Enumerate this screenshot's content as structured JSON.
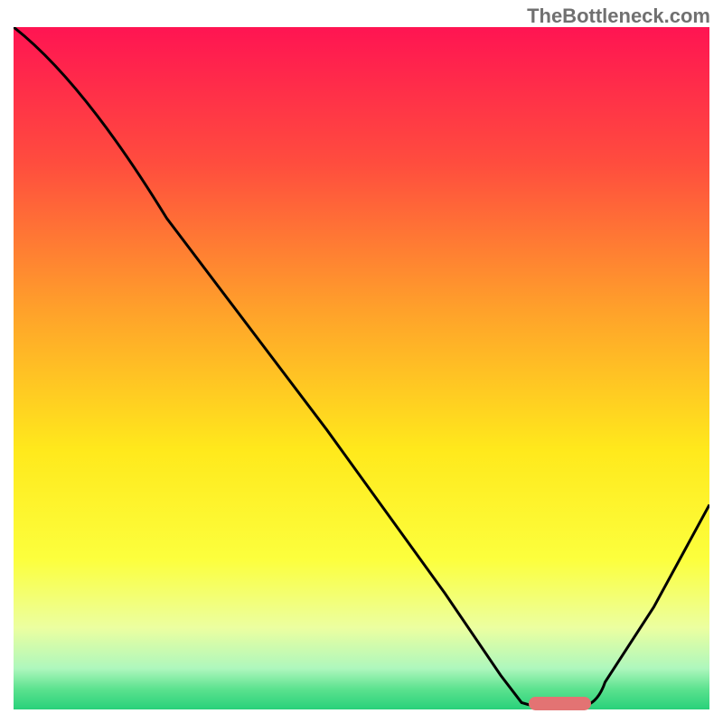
{
  "watermark": "TheBottleneck.com",
  "chart_data": {
    "type": "line",
    "title": "",
    "xlabel": "",
    "ylabel": "",
    "x_range": [
      0,
      100
    ],
    "y_range": [
      0,
      100
    ],
    "gradient_stops": [
      {
        "offset": 0,
        "color": "#ff1452"
      },
      {
        "offset": 20,
        "color": "#ff4d3e"
      },
      {
        "offset": 42,
        "color": "#ffa32a"
      },
      {
        "offset": 62,
        "color": "#ffe91c"
      },
      {
        "offset": 78,
        "color": "#fcff3d"
      },
      {
        "offset": 88,
        "color": "#ecffa0"
      },
      {
        "offset": 94,
        "color": "#aef7bd"
      },
      {
        "offset": 97,
        "color": "#5ce28f"
      },
      {
        "offset": 100,
        "color": "#28d17a"
      }
    ],
    "curve_points": [
      {
        "x": 0,
        "y": 100
      },
      {
        "x": 12,
        "y": 85
      },
      {
        "x": 22,
        "y": 72
      },
      {
        "x": 45,
        "y": 41
      },
      {
        "x": 62,
        "y": 17
      },
      {
        "x": 70,
        "y": 5
      },
      {
        "x": 73,
        "y": 1
      },
      {
        "x": 78,
        "y": 0.5
      },
      {
        "x": 82,
        "y": 0.5
      },
      {
        "x": 85,
        "y": 4
      },
      {
        "x": 92,
        "y": 15
      },
      {
        "x": 100,
        "y": 30
      }
    ],
    "marker": {
      "x_start": 74,
      "x_end": 83,
      "y": 0.5
    }
  }
}
